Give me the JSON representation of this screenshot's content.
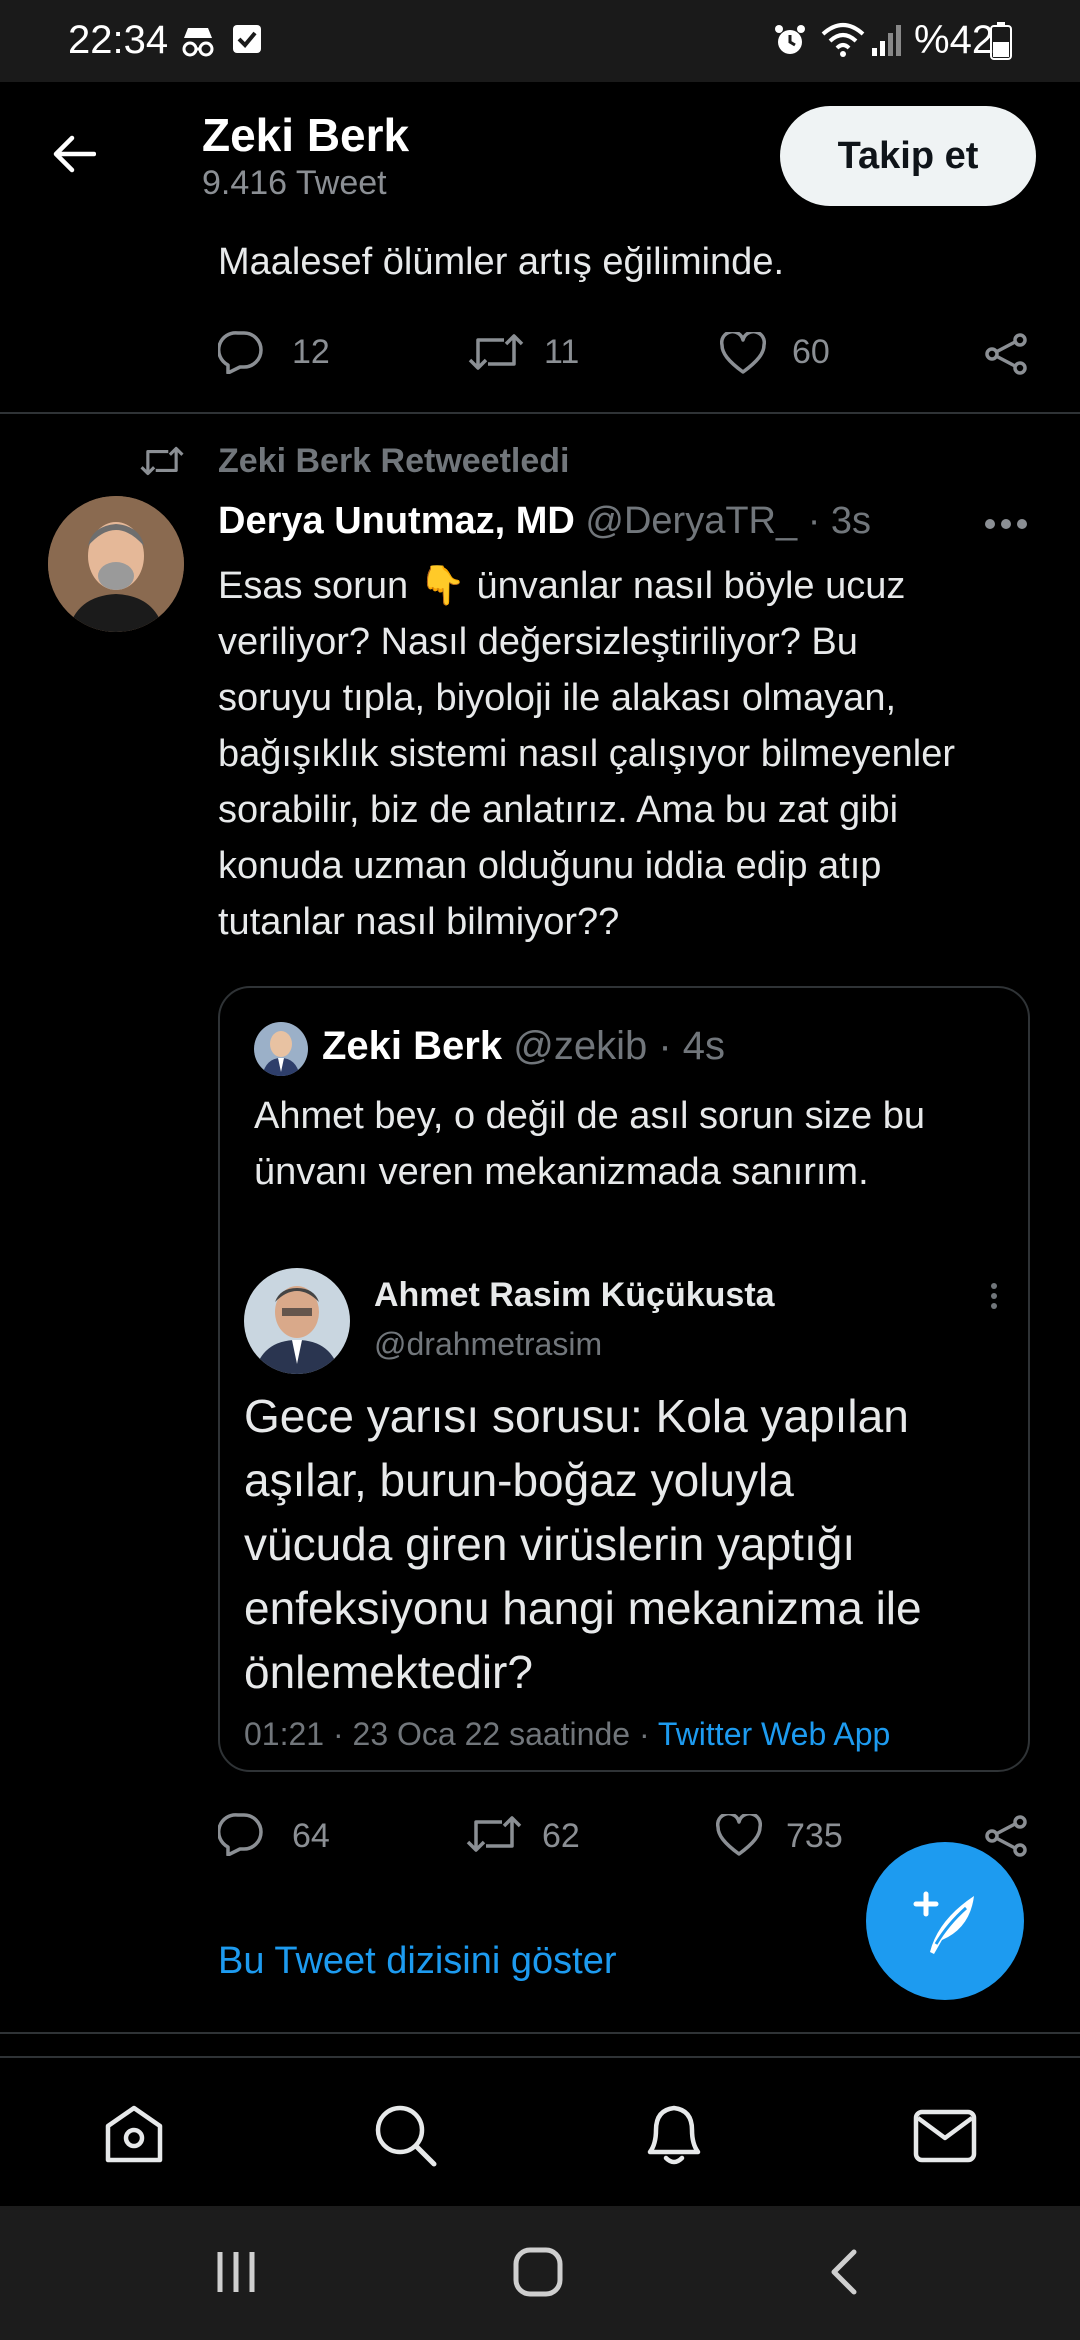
{
  "status_bar": {
    "time": "22:34",
    "battery": "%42"
  },
  "header": {
    "name": "Zeki Berk",
    "tweet_count": "9.416 Tweet",
    "follow_label": "Takip et"
  },
  "prev_tweet": {
    "text": "Maalesef ölümler artış eğiliminde.",
    "replies": "12",
    "retweets": "11",
    "likes": "60"
  },
  "tweet": {
    "retweeted_by": "Zeki Berk Retweetledi",
    "author_name": "Derya Unutmaz, MD",
    "author_handle": "@DeryaTR_",
    "time": "· 3s",
    "lines": [
      "Esas sorun 👇 ünvanlar nasıl böyle ucuz",
      "veriliyor? Nasıl değersizleştiriliyor? Bu",
      "soruyu tıpla, biyoloji ile alakası olmayan,",
      "bağışıklık sistemi nasıl çalışıyor bilmeyenler",
      "sorabilir, biz de anlatırız. Ama bu zat gibi",
      "konuda uzman olduğunu iddia edip atıp",
      "tutanlar nasıl bilmiyor??"
    ],
    "replies": "64",
    "retweets": "62",
    "likes": "735",
    "show_thread": "Bu Tweet dizisini göster"
  },
  "quote": {
    "author_name": "Zeki Berk",
    "author_handle": "@zekib",
    "time": "· 4s",
    "lines": [
      "Ahmet bey, o değil de asıl sorun size bu",
      "ünvanı veren mekanizmada sanırım."
    ],
    "embed": {
      "author_name": "Ahmet Rasim Küçükusta",
      "author_handle": "@drahmetrasim",
      "lines": [
        "Gece yarısı sorusu: Kola yapılan",
        "aşılar, burun-boğaz yoluyla",
        "vücuda giren virüslerin yaptığı",
        "enfeksiyonu hangi mekanizma ile",
        "önlemektedir?"
      ],
      "timestamp": "01:21 · 23 Oca 22 saatinde · ",
      "source": "Twitter Web App"
    }
  },
  "colors": {
    "accent": "#1d9bf0",
    "background": "#000000",
    "secondary_text": "#71767b"
  },
  "icons": [
    "back-arrow-icon",
    "reply-icon",
    "retweet-icon",
    "like-icon",
    "share-icon",
    "more-icon",
    "compose-icon",
    "home-icon",
    "search-icon",
    "notifications-icon",
    "messages-icon"
  ]
}
